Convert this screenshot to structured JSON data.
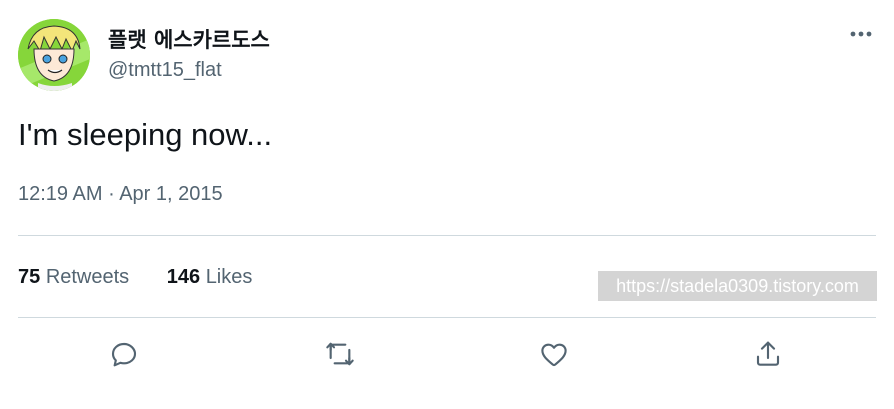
{
  "author": {
    "display_name": "플랫 에스카르도스",
    "handle": "@tmtt15_flat",
    "avatar_alt": "avatar"
  },
  "tweet": {
    "text": "I'm sleeping now...",
    "time": "12:19 AM",
    "separator": "·",
    "date": "Apr 1, 2015"
  },
  "stats": {
    "retweets_count": "75",
    "retweets_label": "Retweets",
    "likes_count": "146",
    "likes_label": "Likes"
  },
  "watermark": "https://stadela0309.tistory.com",
  "icons": {
    "more": "more-dots-icon",
    "reply": "reply-icon",
    "retweet": "retweet-icon",
    "like": "heart-icon",
    "share": "share-icon"
  },
  "colors": {
    "text": "#0f1419",
    "secondary": "#536471",
    "divider": "#cfd9de",
    "watermark_bg": "#d4d4d4"
  }
}
